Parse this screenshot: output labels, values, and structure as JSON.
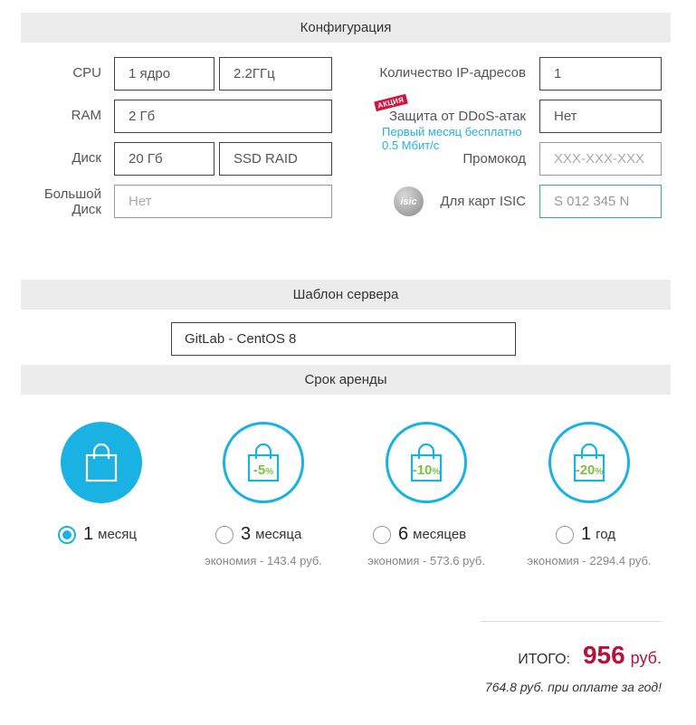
{
  "config": {
    "title": "Конфигурация",
    "cpu": {
      "label": "CPU",
      "cores": "1 ядро",
      "freq": "2.2ГГц"
    },
    "ram": {
      "label": "RAM",
      "value": "2 Гб"
    },
    "disk": {
      "label": "Диск",
      "size": "20 Гб",
      "type": "SSD RAID"
    },
    "bigdisk": {
      "label_line1": "Большой",
      "label_line2": "Диск",
      "placeholder": "Нет"
    },
    "ip": {
      "label": "Количество IP-адресов",
      "value": "1"
    },
    "ddos": {
      "badge": "АКЦИЯ",
      "label": "Защита от DDoS-атак",
      "value": "Нет",
      "promo_line1": "Первый месяц бесплатно",
      "promo_line2": "0.5 Мбит/с"
    },
    "promocode": {
      "label": "Промокод",
      "placeholder": "XXX-XXX-XXX"
    },
    "isic": {
      "logo_text": "isic",
      "label": "Для карт ISIC",
      "placeholder": "S 012 345 N"
    }
  },
  "template": {
    "title": "Шаблон сервера",
    "value": "GitLab - CentOS 8"
  },
  "term": {
    "title": "Срок аренды",
    "options": [
      {
        "num": "1",
        "unit": "месяц",
        "discount": "",
        "saving": "",
        "selected": true
      },
      {
        "num": "3",
        "unit": "месяца",
        "discount": "-5%",
        "saving": "экономия - 143.4 руб.",
        "selected": false
      },
      {
        "num": "6",
        "unit": "месяцев",
        "discount": "-10%",
        "saving": "экономия - 573.6 руб.",
        "selected": false
      },
      {
        "num": "1",
        "unit": "год",
        "discount": "-20%",
        "saving": "экономия - 2294.4 руб.",
        "selected": false
      }
    ]
  },
  "total": {
    "label": "ИТОГО:",
    "amount": "956",
    "currency": "руб.",
    "yearly_note": "764.8 руб. при оплате за год!"
  },
  "colors": {
    "accent": "#1ab1e3",
    "discount": "#7cc242",
    "price": "#b5123d",
    "promo_badge": "#d0143f"
  }
}
